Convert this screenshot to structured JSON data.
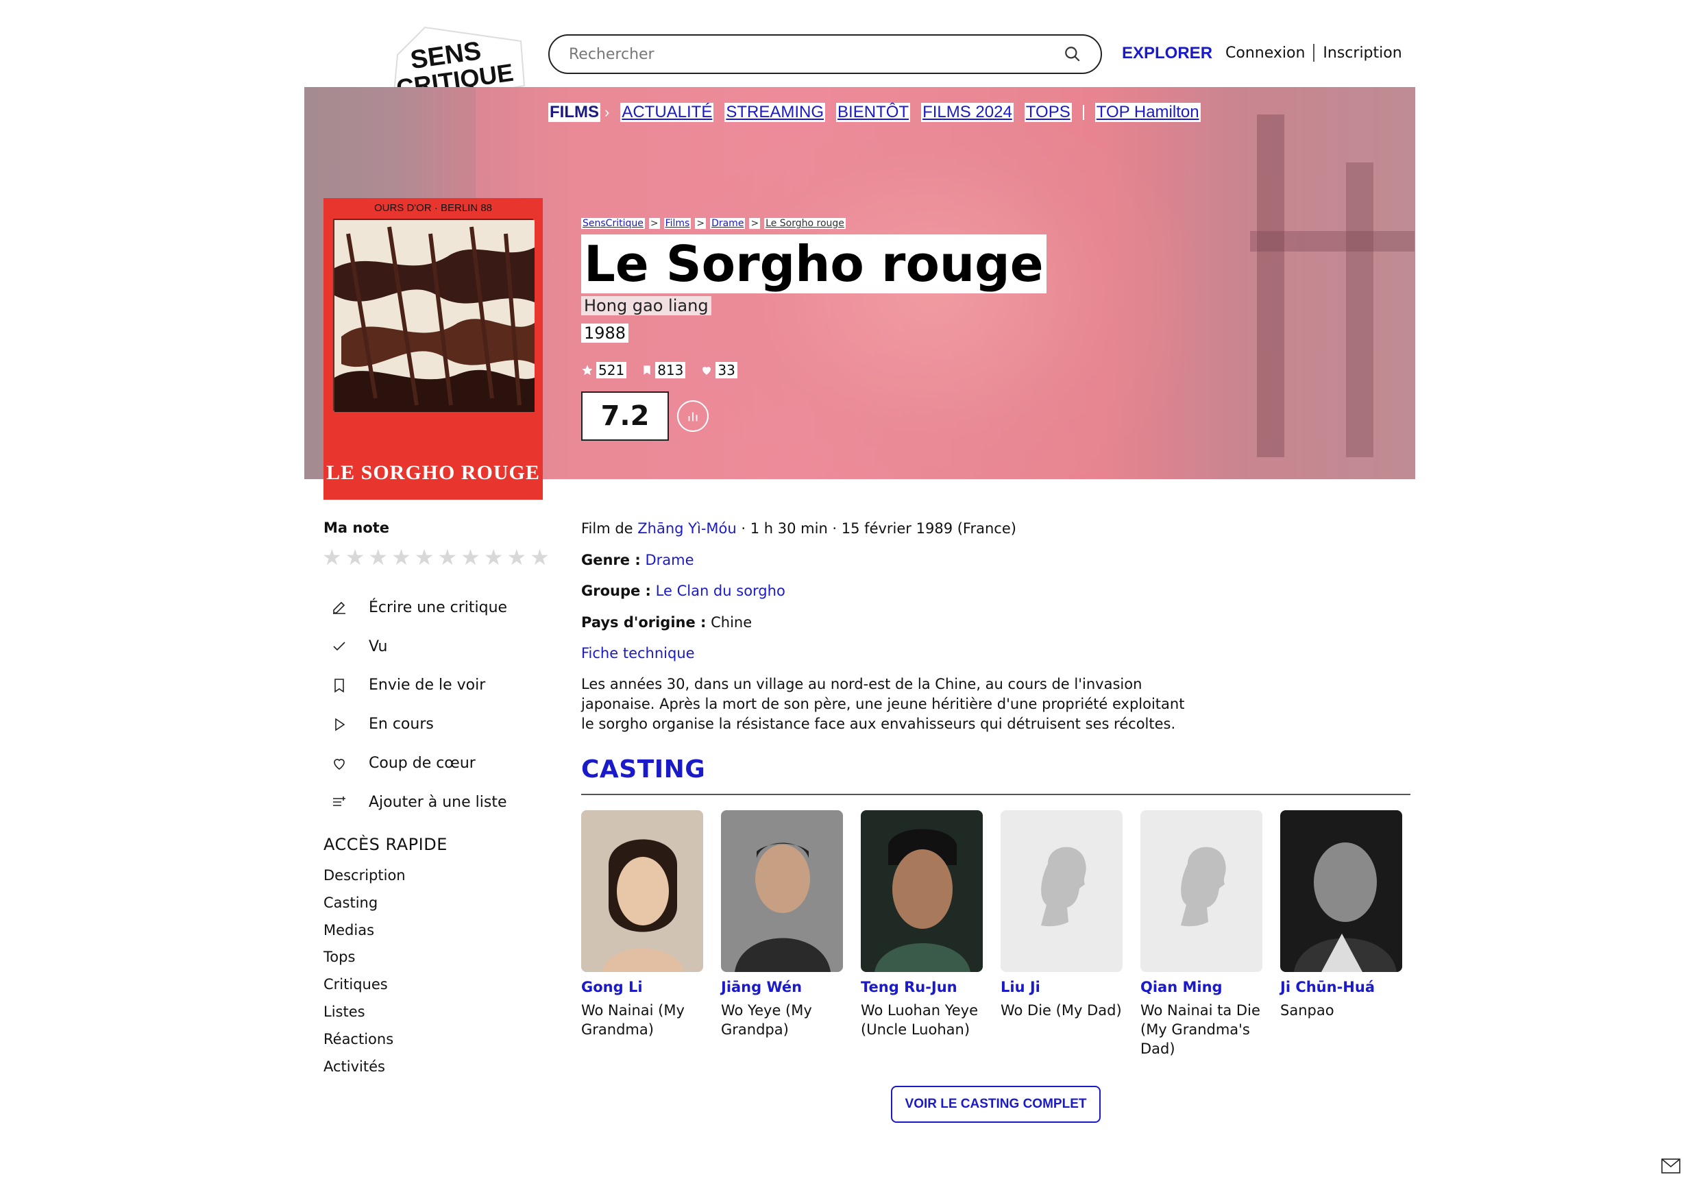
{
  "header": {
    "logo_text_1": "SENS",
    "logo_text_2": "CRITIQUE",
    "search_placeholder": "Rechercher",
    "explorer": "EXPLORER",
    "login": "Connexion",
    "signup": "Inscription"
  },
  "subnav": {
    "items": [
      "FILMS",
      "ACTUALITÉ",
      "STREAMING",
      "BIENTÔT",
      "FILMS 2024",
      "TOPS",
      "TOP Hamilton"
    ]
  },
  "poster": {
    "top_text": "OURS D'OR · BERLIN 88",
    "bottom_text": "LE SORGHO ROUGE"
  },
  "breadcrumb": [
    "SensCritique",
    "Films",
    "Drame",
    "Le Sorgho rouge"
  ],
  "breadcrumb_sep": ">",
  "movie": {
    "title": "Le Sorgho rouge",
    "original_title": "Hong gao liang",
    "year": "1988",
    "ratings_count": "521",
    "wishlist_count": "813",
    "favorites_count": "33",
    "score": "7.2",
    "director_prefix": "Film de",
    "director": "Zhāng Yì-Móu",
    "details_suffix": "· 1 h 30 min · 15 février 1989 (France)",
    "genre_label": "Genre :",
    "genre": "Drame",
    "group_label": "Groupe :",
    "group": "Le Clan du sorgho",
    "country_label": "Pays d'origine :",
    "country": "Chine",
    "tech_sheet": "Fiche technique",
    "synopsis": "Les années 30, dans un village au nord-est de la Chine, au cours de l'invasion japonaise. Après la mort de son père, une jeune héritière d'une propriété exploitant le sorgho organise la résistance face aux envahisseurs qui détruisent ses récoltes."
  },
  "my_rating": {
    "label": "Ma note",
    "max_stars": 10
  },
  "actions": [
    {
      "label": "Écrire une critique",
      "icon": "pencil-icon"
    },
    {
      "label": "Vu",
      "icon": "check-icon"
    },
    {
      "label": "Envie de le voir",
      "icon": "bookmark-icon"
    },
    {
      "label": "En cours",
      "icon": "play-icon"
    },
    {
      "label": "Coup de cœur",
      "icon": "heart-icon"
    },
    {
      "label": "Ajouter à une liste",
      "icon": "list-add-icon"
    }
  ],
  "quick_access": {
    "title": "ACCÈS RAPIDE",
    "links": [
      "Description",
      "Casting",
      "Medias",
      "Tops",
      "Critiques",
      "Listes",
      "Réactions",
      "Activités"
    ]
  },
  "casting": {
    "title": "CASTING",
    "members": [
      {
        "name": "Gong Li",
        "role": "Wo Nainai (My Grandma)",
        "photo": "portrait"
      },
      {
        "name": "Jiāng Wén",
        "role": "Wo Yeye (My Grandpa)",
        "photo": "portrait"
      },
      {
        "name": "Teng Ru-Jun",
        "role": "Wo Luohan Yeye (Uncle Luohan)",
        "photo": "portrait"
      },
      {
        "name": "Liu Ji",
        "role": "Wo Die (My Dad)",
        "photo": "placeholder"
      },
      {
        "name": "Qian Ming",
        "role": "Wo Nainai ta Die (My Grandma's Dad)",
        "photo": "placeholder"
      },
      {
        "name": "Ji Chūn-Huá",
        "role": "Sanpao",
        "photo": "portrait"
      }
    ],
    "full_cast_button": "VOIR LE CASTING COMPLET"
  },
  "colors": {
    "accent": "#1a1ac8",
    "hero": "#ee8b9a",
    "poster": "#e8362e"
  }
}
